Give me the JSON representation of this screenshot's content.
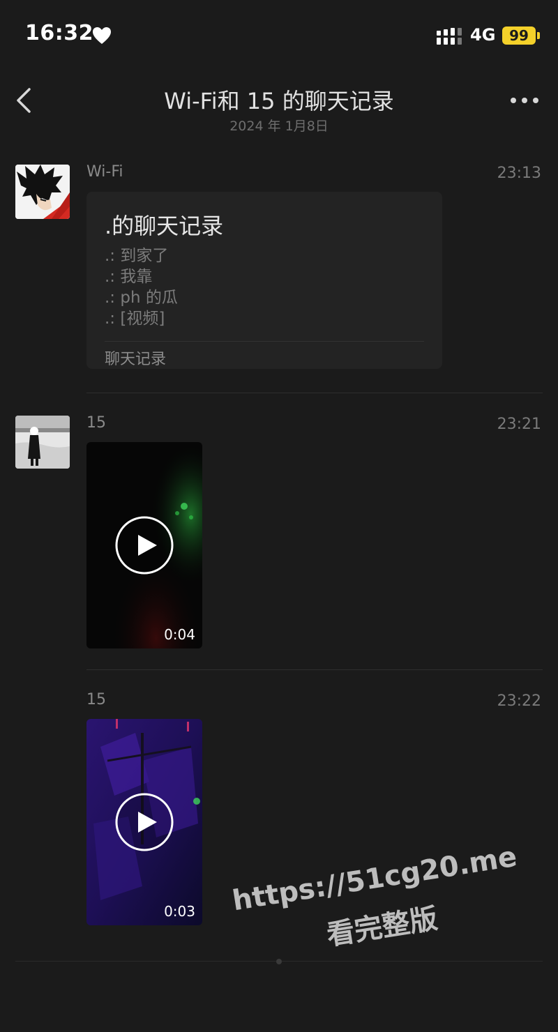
{
  "status_bar": {
    "time": "16:32",
    "network": "4G",
    "battery": "99"
  },
  "nav": {
    "title": "Wi-Fi和 15 的聊天记录",
    "subtitle": "2024 年 1月8日"
  },
  "messages": [
    {
      "sender": "Wi-Fi",
      "time": "23:13",
      "type": "chat-record",
      "record": {
        "title": ".的聊天记录",
        "lines": [
          ".: 到家了",
          ".: 我靠",
          ".: ph 的瓜",
          ".: [视频]"
        ],
        "footer": "聊天记录"
      }
    },
    {
      "sender": "15",
      "time": "23:21",
      "type": "video",
      "duration": "0:04"
    },
    {
      "sender": "15",
      "time": "23:22",
      "type": "video",
      "duration": "0:03"
    }
  ],
  "watermark": {
    "line1": "https://51cg20.me",
    "line2": "看完整版"
  },
  "colors": {
    "background": "#1b1b1b",
    "card": "#232323",
    "battery": "#f4d12a"
  },
  "icons": [
    "heart-icon",
    "signal-icon",
    "back-chevron-icon",
    "more-icon",
    "play-icon"
  ]
}
